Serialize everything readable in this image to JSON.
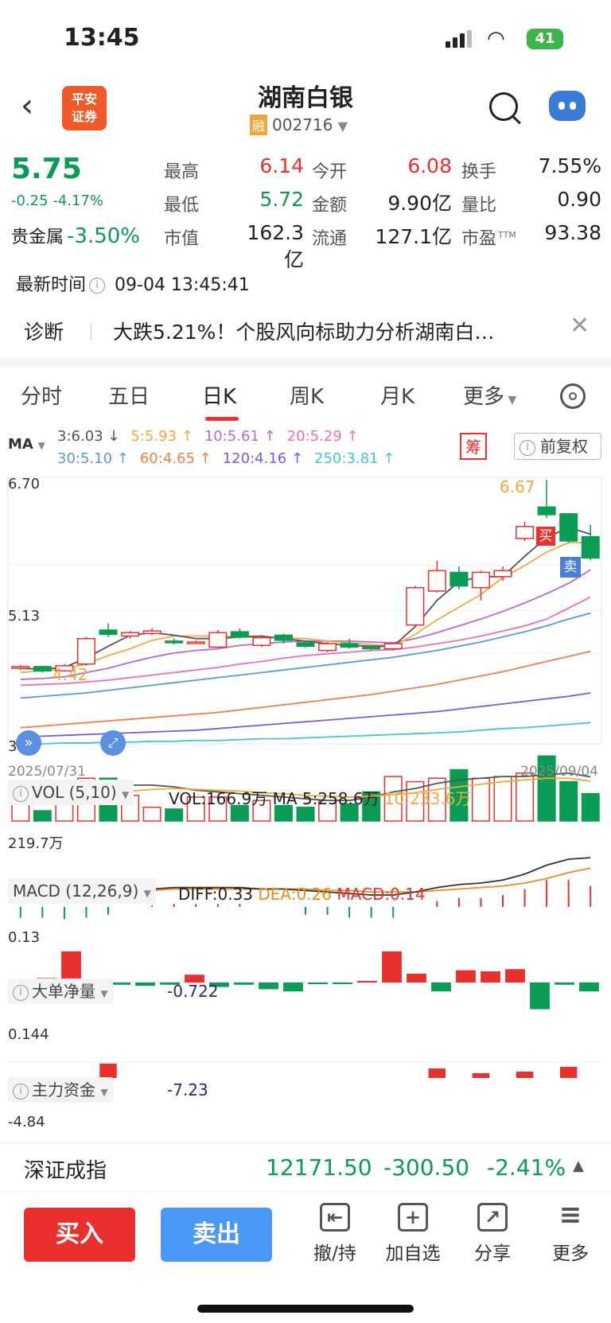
{
  "status": {
    "time": "13:45",
    "battery": "41"
  },
  "header": {
    "broker_logo": [
      "平安",
      "证券"
    ],
    "title": "湖南白银",
    "margin_badge": "融",
    "code": "002716"
  },
  "quote": {
    "price": "5.75",
    "change": "-0.25",
    "change_pct": "-4.17%",
    "sector_name": "贵金属",
    "sector_chg": "-3.50%",
    "grid": [
      {
        "label": "最高",
        "value": "6.14",
        "tone": "red"
      },
      {
        "label": "今开",
        "value": "6.08",
        "tone": "red"
      },
      {
        "label": "换手",
        "value": "7.55%",
        "tone": ""
      },
      {
        "label": "最低",
        "value": "5.72",
        "tone": "green"
      },
      {
        "label": "金额",
        "value": "9.90亿",
        "tone": ""
      },
      {
        "label": "量比",
        "value": "0.90",
        "tone": ""
      },
      {
        "label": "市值",
        "value": "162.3亿",
        "tone": ""
      },
      {
        "label": "流通",
        "value": "127.1亿",
        "tone": ""
      },
      {
        "label": "市盈",
        "value": "93.38",
        "tone": "",
        "sup": "TTM"
      }
    ],
    "update_label": "最新时间",
    "update_time": "09-04 13:45:41"
  },
  "diagnosis": {
    "label": "诊断",
    "text": "大跌5.21%！个股风向标助力分析湖南白…",
    "close": "✕"
  },
  "tabs": [
    "分时",
    "五日",
    "日K",
    "周K",
    "月K",
    "更多"
  ],
  "ma": {
    "label": "MA",
    "row1": [
      {
        "t": "3:6.03 ↓",
        "c": "#555"
      },
      {
        "t": "5:5.93 ↑",
        "c": "#f2a93b"
      },
      {
        "t": "10:5.61 ↑",
        "c": "#b36bd9"
      },
      {
        "t": "20:5.29 ↑",
        "c": "#ef6fb4"
      }
    ],
    "row2": [
      {
        "t": "30:5.10 ↑",
        "c": "#5b9bd5"
      },
      {
        "t": "60:4.65 ↑",
        "c": "#f0804a"
      },
      {
        "t": "120:4.16 ↑",
        "c": "#6a62e0"
      },
      {
        "t": "250:3.81 ↑",
        "c": "#45c6cf"
      }
    ],
    "chou": "筹",
    "fq": "前复权"
  },
  "kline": {
    "y_top": "6.70",
    "y_mid": "5.13",
    "y_bot": "3.56",
    "high_mark": "6.67",
    "low_mark": "4.42",
    "buy": "买",
    "sell": "卖",
    "date_start": "2025/07/31",
    "date_end": "2025/09/04",
    "candles": [
      [
        4.45,
        4.47,
        4.49,
        4.43
      ],
      [
        4.47,
        4.42,
        4.48,
        4.4
      ],
      [
        4.42,
        4.48,
        4.5,
        4.41
      ],
      [
        4.5,
        4.8,
        4.82,
        4.48
      ],
      [
        4.9,
        4.85,
        4.98,
        4.82
      ],
      [
        4.83,
        4.87,
        4.89,
        4.8
      ],
      [
        4.86,
        4.89,
        4.92,
        4.84
      ],
      [
        4.77,
        4.76,
        4.8,
        4.73
      ],
      [
        4.76,
        4.76,
        4.78,
        4.74
      ],
      [
        4.7,
        4.87,
        4.9,
        4.69
      ],
      [
        4.88,
        4.82,
        4.92,
        4.8
      ],
      [
        4.72,
        4.81,
        4.84,
        4.7
      ],
      [
        4.84,
        4.78,
        4.86,
        4.74
      ],
      [
        4.75,
        4.71,
        4.77,
        4.69
      ],
      [
        4.66,
        4.74,
        4.76,
        4.64
      ],
      [
        4.74,
        4.7,
        4.8,
        4.68
      ],
      [
        4.7,
        4.68,
        4.72,
        4.66
      ],
      [
        4.68,
        4.74,
        4.76,
        4.66
      ],
      [
        4.96,
        5.4,
        5.42,
        4.95
      ],
      [
        5.36,
        5.6,
        5.72,
        5.34
      ],
      [
        5.58,
        5.42,
        5.65,
        5.38
      ],
      [
        5.4,
        5.58,
        5.6,
        5.25
      ],
      [
        5.53,
        5.6,
        5.65,
        5.48
      ],
      [
        5.98,
        6.12,
        6.18,
        5.95
      ],
      [
        6.35,
        6.26,
        6.67,
        6.22
      ],
      [
        6.27,
        5.95,
        6.28,
        5.93
      ],
      [
        6.0,
        5.75,
        6.14,
        5.72
      ]
    ],
    "ma3": [
      4.45,
      4.44,
      4.46,
      4.57,
      4.71,
      4.84,
      4.87,
      4.84,
      4.8,
      4.8,
      4.82,
      4.83,
      4.8,
      4.77,
      4.74,
      4.72,
      4.71,
      4.71,
      4.94,
      5.25,
      5.47,
      5.53,
      5.53,
      5.77,
      5.99,
      6.11,
      6.03
    ],
    "ma5": [
      4.4,
      4.42,
      4.44,
      4.5,
      4.6,
      4.68,
      4.78,
      4.83,
      4.83,
      4.83,
      4.82,
      4.81,
      4.81,
      4.8,
      4.77,
      4.75,
      4.73,
      4.71,
      4.85,
      5.02,
      5.17,
      5.32,
      5.52,
      5.66,
      5.82,
      5.93,
      5.93
    ],
    "ma10": [
      4.32,
      4.33,
      4.35,
      4.4,
      4.45,
      4.52,
      4.58,
      4.63,
      4.66,
      4.68,
      4.72,
      4.74,
      4.76,
      4.77,
      4.77,
      4.77,
      4.76,
      4.75,
      4.8,
      4.87,
      4.95,
      5.03,
      5.12,
      5.22,
      5.33,
      5.45,
      5.61
    ],
    "ma20": [
      4.25,
      4.26,
      4.27,
      4.29,
      4.31,
      4.34,
      4.37,
      4.4,
      4.43,
      4.46,
      4.5,
      4.53,
      4.57,
      4.6,
      4.62,
      4.64,
      4.66,
      4.67,
      4.7,
      4.74,
      4.78,
      4.83,
      4.89,
      4.95,
      5.03,
      5.16,
      5.29
    ],
    "ma30": [
      4.1,
      4.12,
      4.14,
      4.16,
      4.19,
      4.22,
      4.25,
      4.28,
      4.31,
      4.34,
      4.37,
      4.4,
      4.43,
      4.46,
      4.49,
      4.52,
      4.55,
      4.58,
      4.62,
      4.66,
      4.71,
      4.76,
      4.82,
      4.88,
      4.95,
      5.03,
      5.1
    ],
    "ma60": [
      3.75,
      3.77,
      3.79,
      3.81,
      3.83,
      3.85,
      3.87,
      3.89,
      3.91,
      3.93,
      3.96,
      3.99,
      4.02,
      4.05,
      4.08,
      4.11,
      4.14,
      4.18,
      4.22,
      4.26,
      4.31,
      4.36,
      4.41,
      4.47,
      4.53,
      4.59,
      4.65
    ],
    "ma120": [
      3.64,
      3.65,
      3.66,
      3.67,
      3.68,
      3.69,
      3.7,
      3.71,
      3.72,
      3.74,
      3.76,
      3.78,
      3.8,
      3.82,
      3.84,
      3.86,
      3.88,
      3.9,
      3.92,
      3.94,
      3.97,
      4.0,
      4.03,
      4.06,
      4.09,
      4.12,
      4.16
    ],
    "ma250": [
      3.56,
      3.56,
      3.57,
      3.57,
      3.58,
      3.58,
      3.59,
      3.59,
      3.6,
      3.6,
      3.61,
      3.62,
      3.62,
      3.63,
      3.64,
      3.65,
      3.66,
      3.67,
      3.68,
      3.69,
      3.7,
      3.72,
      3.74,
      3.75,
      3.77,
      3.79,
      3.81
    ]
  },
  "volume": {
    "label": "VOL (5,10)",
    "vol": "VOL:166.9万",
    "ma_label": "MA",
    "ma5": "5:258.6万",
    "ma10": "10:233.6万",
    "y_label": "219.7万",
    "bars": [
      120,
      60,
      140,
      250,
      250,
      150,
      80,
      70,
      140,
      140,
      90,
      120,
      90,
      80,
      120,
      100,
      170,
      260,
      230,
      250,
      300,
      250,
      260,
      280,
      380,
      230,
      160
    ],
    "ma5_line": [
      120,
      110,
      130,
      160,
      190,
      210,
      210,
      200,
      180,
      170,
      160,
      150,
      140,
      130,
      120,
      120,
      140,
      170,
      190,
      220,
      240,
      250,
      260,
      260,
      270,
      280,
      258
    ],
    "ma10_line": [
      130,
      125,
      130,
      140,
      160,
      175,
      185,
      190,
      185,
      180,
      175,
      165,
      160,
      150,
      145,
      140,
      145,
      155,
      165,
      185,
      200,
      215,
      230,
      240,
      250,
      250,
      233
    ]
  },
  "macd": {
    "label": "MACD (12,26,9)",
    "diff": "DIFF:0.33",
    "dea": "DEA:0.26",
    "macd": "MACD:0.14",
    "y_label": "0.13",
    "diff_line": [
      0.1,
      0.09,
      0.08,
      0.09,
      0.1,
      0.11,
      0.12,
      0.13,
      0.13,
      0.13,
      0.13,
      0.12,
      0.12,
      0.11,
      0.1,
      0.09,
      0.08,
      0.08,
      0.1,
      0.13,
      0.15,
      0.16,
      0.18,
      0.22,
      0.28,
      0.32,
      0.33
    ],
    "dea_line": [
      0.12,
      0.11,
      0.11,
      0.11,
      0.11,
      0.11,
      0.11,
      0.12,
      0.12,
      0.12,
      0.12,
      0.12,
      0.12,
      0.12,
      0.11,
      0.11,
      0.1,
      0.1,
      0.1,
      0.11,
      0.12,
      0.13,
      0.14,
      0.16,
      0.19,
      0.23,
      0.26
    ],
    "hist": [
      -0.04,
      -0.04,
      -0.05,
      -0.04,
      -0.02,
      0.0,
      0.01,
      0.02,
      0.02,
      0.02,
      0.02,
      0.0,
      0.0,
      -0.02,
      -0.02,
      -0.04,
      -0.04,
      -0.04,
      0.0,
      0.04,
      0.06,
      0.06,
      0.08,
      0.12,
      0.18,
      0.18,
      0.14
    ]
  },
  "big_order": {
    "label": "大单净量",
    "value": "-0.722",
    "y_label": "0.144",
    "bars": [
      -0.3,
      0.2,
      1.4,
      -0.1,
      -0.1,
      -0.15,
      -0.1,
      0.35,
      -0.2,
      -0.1,
      -0.3,
      -0.4,
      -0.05,
      -0.05,
      0.05,
      1.4,
      0.4,
      -0.4,
      0.55,
      0.5,
      0.6,
      -1.2,
      -0.1,
      -0.4
    ]
  },
  "main_fund": {
    "label": "主力资金",
    "value": "-7.23",
    "y_label": "-4.84"
  },
  "index": {
    "name": "深证成指",
    "value": "12171.50",
    "chg": "-300.50",
    "pct": "-2.41%"
  },
  "bottom": {
    "buy": "买入",
    "sell": "卖出",
    "tools": [
      {
        "label": "撤/持",
        "icon": "⇤"
      },
      {
        "label": "加自选",
        "icon": "+"
      },
      {
        "label": "分享",
        "icon": "↗"
      },
      {
        "label": "更多",
        "icon": "≡"
      }
    ]
  },
  "colors": {
    "up": "#e8312f",
    "down": "#0a9b55"
  }
}
